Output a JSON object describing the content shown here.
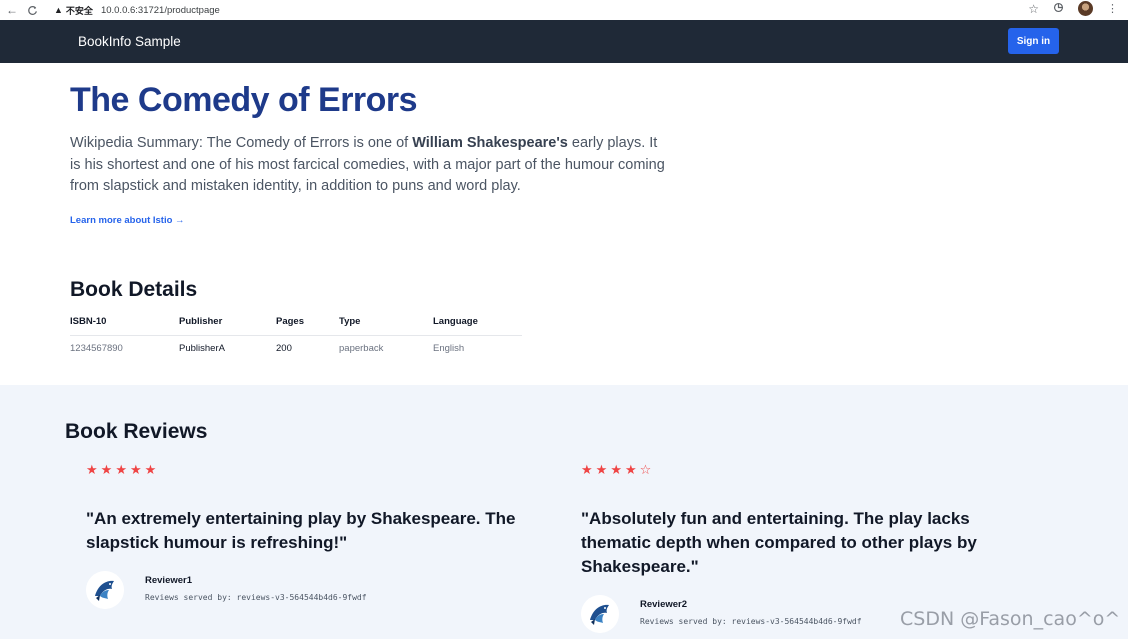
{
  "browser": {
    "back_icon": "←",
    "reload_icon": "C",
    "security_label": "不安全",
    "url": "10.0.0.6:31721/productpage"
  },
  "navbar": {
    "brand": "BookInfo Sample",
    "sign_in": "Sign in"
  },
  "hero": {
    "title": "The Comedy of Errors",
    "summary_prefix": "Wikipedia Summary: The Comedy of Errors is one of ",
    "summary_bold": "William Shakespeare's",
    "summary_suffix": " early plays. It is his shortest and one of his most farcical comedies, with a major part of the humour coming from slapstick and mistaken identity, in addition to puns and word play.",
    "learn_more": "Learn more about Istio →"
  },
  "details": {
    "title": "Book Details",
    "headers": [
      "ISBN-10",
      "Publisher",
      "Pages",
      "Type",
      "Language"
    ],
    "row": [
      "1234567890",
      "PublisherA",
      "200",
      "paperback",
      "English"
    ]
  },
  "reviews": {
    "title": "Book Reviews",
    "items": [
      {
        "rating": 5,
        "max_rating": 5,
        "quote": "\"An extremely entertaining play by Shakespeare. The slapstick humour is refreshing!\"",
        "reviewer": "Reviewer1",
        "served_by": "Reviews served by: reviews-v3-564544b4d6-9fwdf"
      },
      {
        "rating": 4,
        "max_rating": 5,
        "quote": "\"Absolutely fun and entertaining. The play lacks thematic depth when compared to other plays by Shakespeare.\"",
        "reviewer": "Reviewer2",
        "served_by": "Reviews served by: reviews-v3-564544b4d6-9fwdf"
      }
    ]
  },
  "colors": {
    "navbar": "#1f2937",
    "primary": "#2563eb",
    "title": "#1e3a8a",
    "star": "#ef4444",
    "reviews_bg": "#f1f5fb"
  },
  "watermark": "CSDN @Fason_cao^o^"
}
